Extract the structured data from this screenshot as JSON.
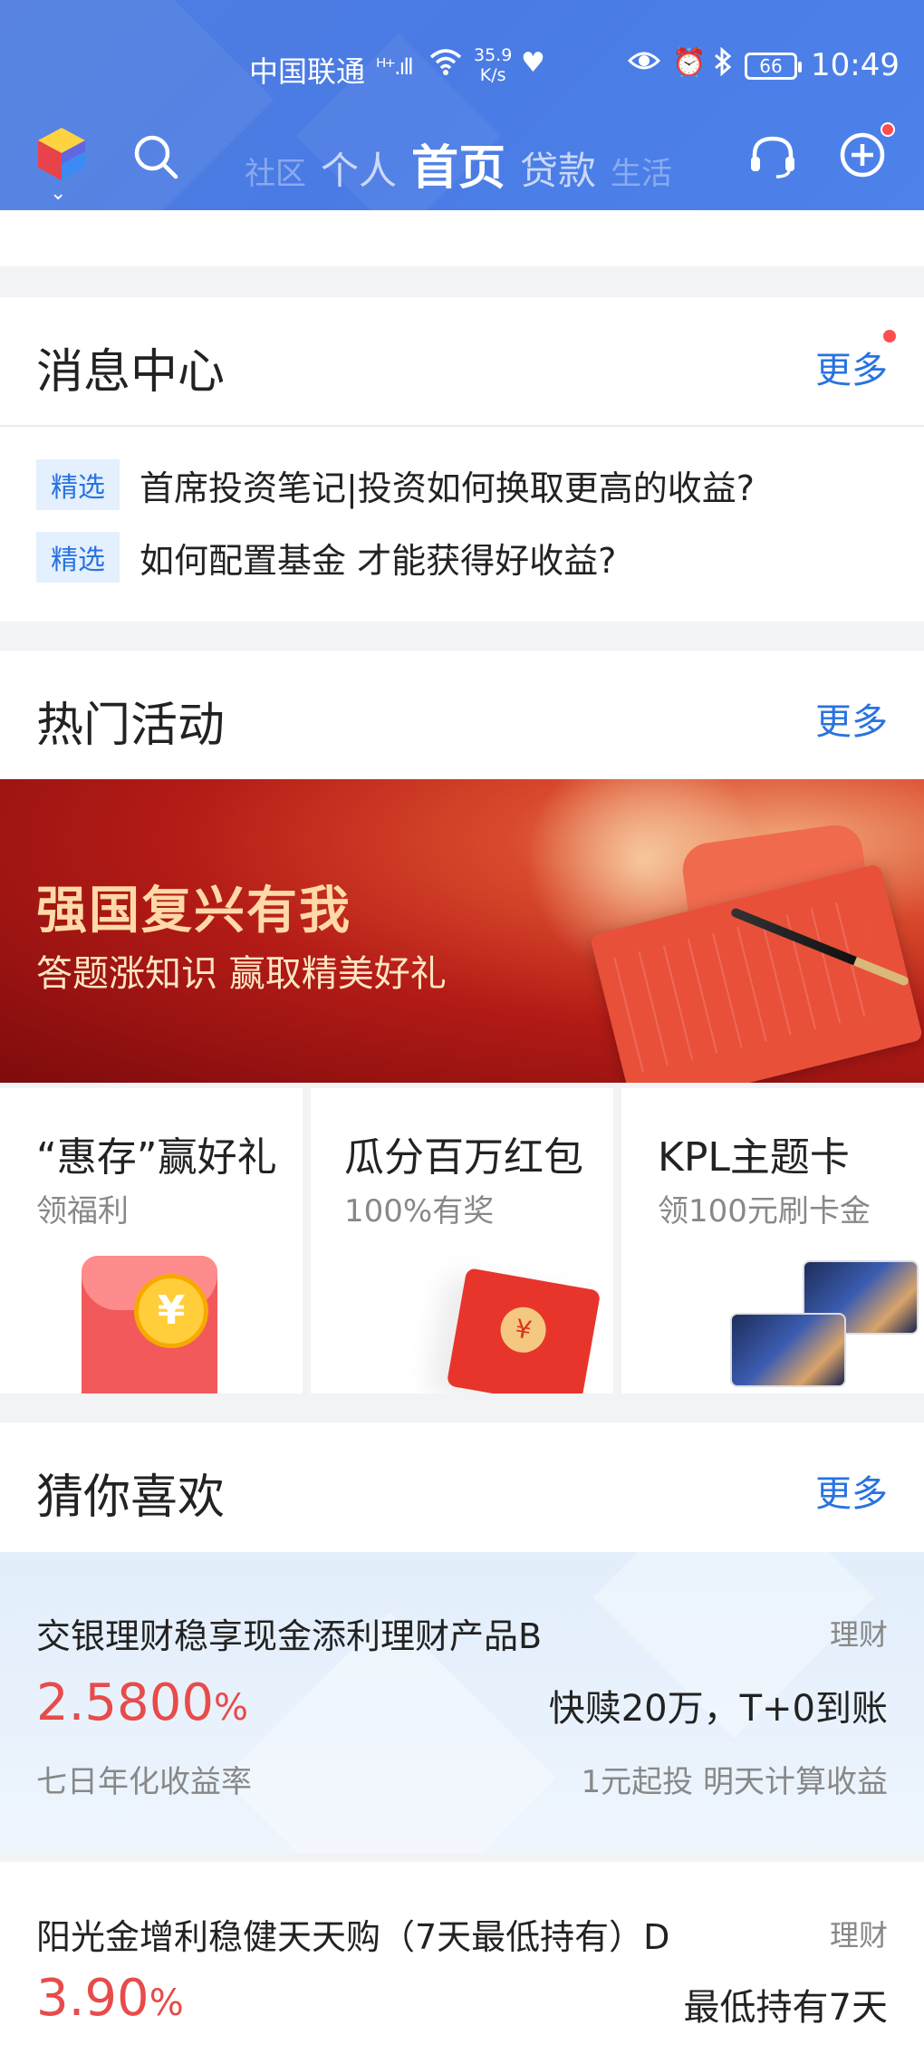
{
  "status_bar": {
    "carrier": "中国联通",
    "signal": "ᴴ⁺.ıll",
    "speed_value": "35.9",
    "speed_unit": "K/s",
    "battery": "66",
    "time": "10:49"
  },
  "nav": {
    "tabs": [
      "社区",
      "个人",
      "首页",
      "贷款",
      "生活"
    ],
    "active_tab": "首页"
  },
  "message_center": {
    "title": "消息中心",
    "more": "更多",
    "items": [
      {
        "tag": "精选",
        "text": "首席投资笔记|投资如何换取更高的收益?"
      },
      {
        "tag": "精选",
        "text": "如何配置基金 才能获得好收益?"
      }
    ]
  },
  "hot_activities": {
    "title": "热门活动",
    "more": "更多",
    "banner_title": "强国复兴有我",
    "banner_subtitle": "答题涨知识 赢取精美好礼",
    "tiles": [
      {
        "title": "“惠存”赢好礼",
        "subtitle": "领福利"
      },
      {
        "title": "瓜分百万红包",
        "subtitle": "100%有奖"
      },
      {
        "title": "KPL主题卡",
        "subtitle": "领100元刷卡金"
      }
    ]
  },
  "guess_you_like": {
    "title": "猜你喜欢",
    "more": "更多",
    "products": [
      {
        "name": "交银理财稳享现金添利理财产品B",
        "category": "理财",
        "rate": "2.5800",
        "rate_unit": "%",
        "rate_label": "七日年化收益率",
        "feature": "快赎20万，T+0到账",
        "note": "1元起投  明天计算收益"
      },
      {
        "name": "阳光金增利稳健天天购（7天最低持有）D",
        "category": "理财",
        "rate": "3.90",
        "rate_unit": "%",
        "feature": "最低持有7天"
      }
    ]
  },
  "colors": {
    "header_blue": "#4a7be4",
    "accent_blue": "#2873e0",
    "rate_red": "#e84b4b",
    "tag_bg": "#e4f0fd"
  }
}
